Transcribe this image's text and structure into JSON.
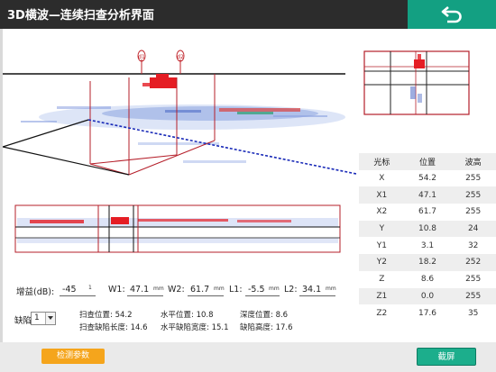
{
  "header": {
    "title": "3D横波—连续扫查分析界面",
    "back_icon": "return-arrow-icon",
    "accent": "#13a082"
  },
  "view": {
    "markers": [
      "d1",
      "d2"
    ],
    "defect_color": "#e51d24",
    "frame_color": "#b51f2a",
    "axis_color": "#1a2bb8"
  },
  "table": {
    "headers": [
      "光标",
      "位置",
      "波高"
    ],
    "rows": [
      {
        "cursor": "X",
        "position": "54.2",
        "amplitude": "255"
      },
      {
        "cursor": "X1",
        "position": "47.1",
        "amplitude": "255"
      },
      {
        "cursor": "X2",
        "position": "61.7",
        "amplitude": "255"
      },
      {
        "cursor": "Y",
        "position": "10.8",
        "amplitude": "24"
      },
      {
        "cursor": "Y1",
        "position": "3.1",
        "amplitude": "32"
      },
      {
        "cursor": "Y2",
        "position": "18.2",
        "amplitude": "252"
      },
      {
        "cursor": "Z",
        "position": "8.6",
        "amplitude": "255"
      },
      {
        "cursor": "Z1",
        "position": "0.0",
        "amplitude": "255"
      },
      {
        "cursor": "Z2",
        "position": "17.6",
        "amplitude": "35"
      }
    ]
  },
  "controls": {
    "gain_label": "增益(dB):",
    "gain_value": "-45",
    "gain_unit": "1",
    "w1_label": "W1:",
    "w1_value": "47.1",
    "w2_label": "W2:",
    "w2_value": "61.7",
    "l1_label": "L1:",
    "l1_value": "-5.5",
    "l2_label": "L2:",
    "l2_value": "34.1",
    "mm": "mm",
    "defect_label": "缺陷:",
    "defect_value": "1"
  },
  "info": {
    "scan_pos": "扫查位置: 54.2",
    "h_pos": "水平位置: 10.8",
    "depth_pos": "深度位置: 8.6",
    "defect_len": "扫查缺陷长度: 14.6",
    "defect_width": "水平缺陷宽度: 15.1",
    "defect_height": "缺陷高度: 17.6"
  },
  "buttons": {
    "params": "检测参数",
    "capture": "截屏",
    "params_color": "#f5a51c",
    "capture_color": "#1cae8c"
  }
}
